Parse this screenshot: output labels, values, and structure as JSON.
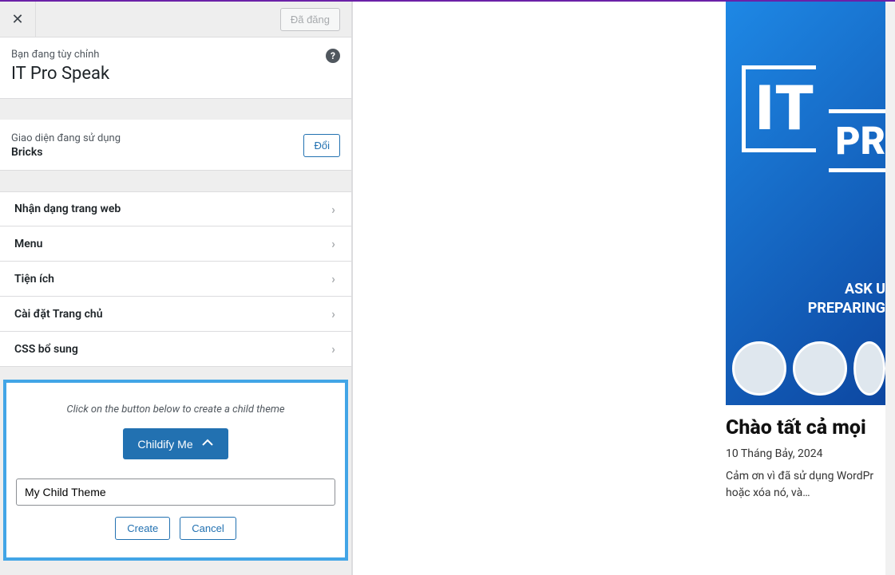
{
  "topbar": {
    "published_label": "Đã đăng"
  },
  "header": {
    "customizing_label": "Bạn đang tùy chỉnh",
    "site_title": "IT Pro Speak"
  },
  "theme": {
    "label": "Giao diện đang sử dụng",
    "name": "Bricks",
    "change_label": "Đổi"
  },
  "menu": {
    "items": [
      {
        "label": "Nhận dạng trang web"
      },
      {
        "label": "Menu"
      },
      {
        "label": "Tiện ích"
      },
      {
        "label": "Cài đặt Trang chủ"
      },
      {
        "label": "CSS bổ sung"
      }
    ]
  },
  "childify": {
    "instruction": "Click on the button below to create a child theme",
    "button_label": "Childify Me",
    "input_value": "My Child Theme",
    "create_label": "Create",
    "cancel_label": "Cancel"
  },
  "preview": {
    "hero_it": "IT",
    "hero_pr": "PR",
    "hero_sub_line1": "ASK U",
    "hero_sub_line2": "PREPARING",
    "post_title": "Chào tất cả mọi ",
    "post_date": "10 Tháng Bảy, 2024",
    "post_excerpt": "Cảm ơn vì đã sử dụng WordPr hoặc xóa nó, và…"
  }
}
